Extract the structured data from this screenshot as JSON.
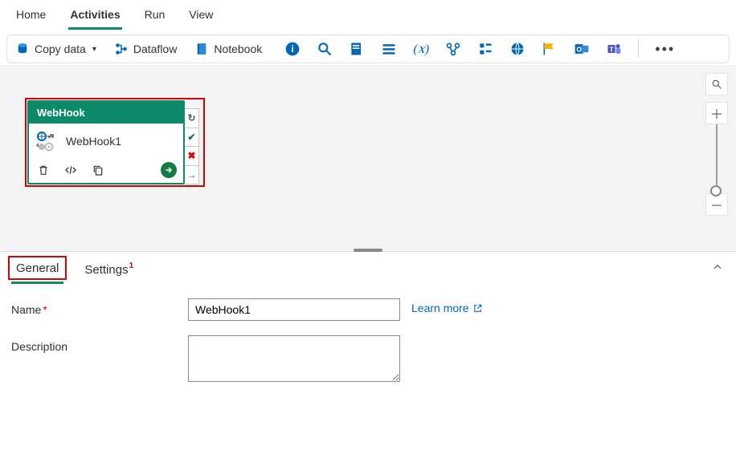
{
  "menu": {
    "home": "Home",
    "activities": "Activities",
    "run": "Run",
    "view": "View"
  },
  "toolbar": {
    "copy_data": "Copy data",
    "dataflow": "Dataflow",
    "notebook": "Notebook"
  },
  "node": {
    "type_label": "WebHook",
    "instance_name": "WebHook1"
  },
  "panel": {
    "tab_general": "General",
    "tab_settings": "Settings",
    "settings_badge": "1",
    "name_label": "Name",
    "desc_label": "Description",
    "name_value": "WebHook1",
    "desc_value": "",
    "learn_more": "Learn more"
  }
}
